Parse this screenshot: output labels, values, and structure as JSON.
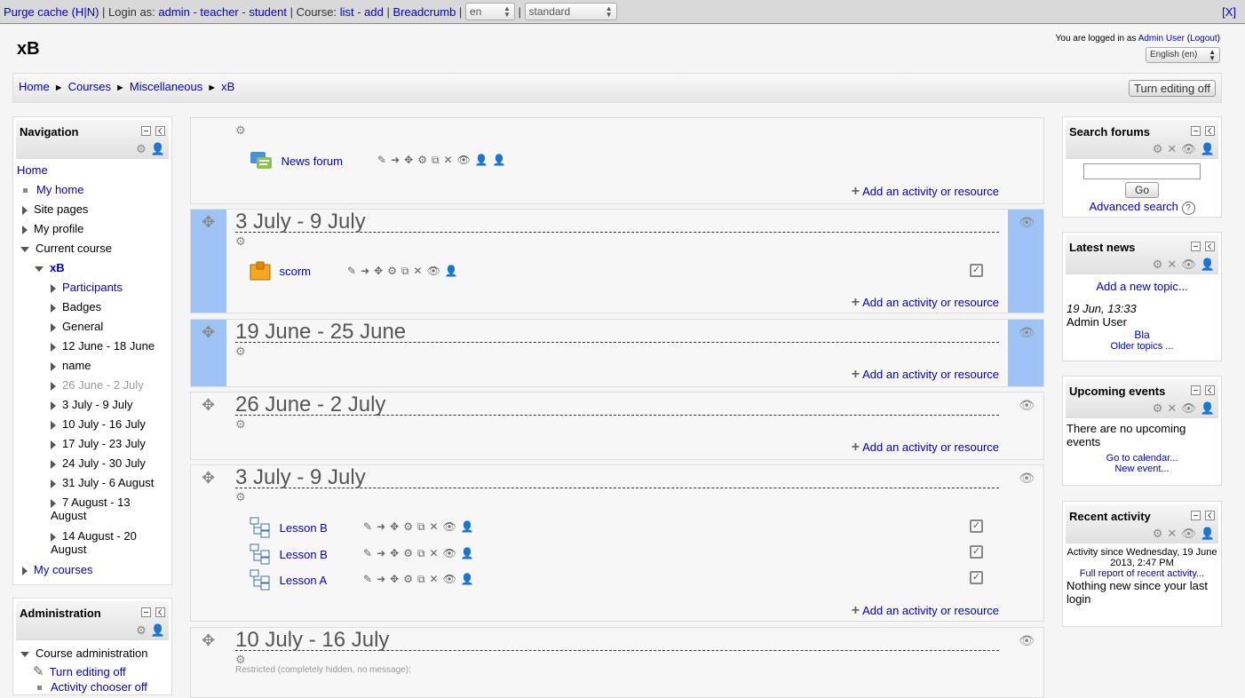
{
  "devbar": {
    "purge": "Purge cache (H|N)",
    "sep1": " | Login as: ",
    "admin": "admin",
    "teacher": "teacher",
    "student": "student",
    "sep2": " | Course: ",
    "list": "list",
    "add": "add",
    "breadcrumb": "Breadcrumb",
    "lang": "en",
    "theme": "standard",
    "close": "[X]"
  },
  "header": {
    "site_name": "xB",
    "logged_in": "You are logged in as",
    "user": "Admin User",
    "logout": "Logout",
    "language": "English (en)"
  },
  "breadcrumb": [
    "Home",
    "Courses",
    "Miscellaneous",
    "xB"
  ],
  "editing_button": "Turn editing off",
  "navigation": {
    "title": "Navigation",
    "home": "Home",
    "my_home": "My home",
    "site_pages": "Site pages",
    "my_profile": "My profile",
    "current_course": "Current course",
    "course": "xB",
    "items": [
      "Participants",
      "Badges",
      "General",
      "12 June - 18 June",
      "name",
      "26 June - 2 July",
      "3 July - 9 July",
      "10 July - 16 July",
      "17 July - 23 July",
      "24 July - 30 July",
      "31 July - 6 August",
      "7 August - 13 August",
      "14 August - 20 August"
    ],
    "my_courses": "My courses"
  },
  "administration": {
    "title": "Administration",
    "course_admin": "Course administration",
    "turn_editing": "Turn editing off",
    "activity_chooser": "Activity chooser off"
  },
  "sections": {
    "add_label": "Add an activity or resource",
    "s0": {
      "activity": "News forum"
    },
    "s1": {
      "title": "3 July - 9 July",
      "activity": "scorm"
    },
    "s2": {
      "title": "19 June - 25 June"
    },
    "s3": {
      "title": "26 June - 2 July"
    },
    "s4": {
      "title": "3 July - 9 July",
      "activities": [
        "Lesson B",
        "Lesson B",
        "Lesson A"
      ]
    },
    "s5": {
      "title": "10 July - 16 July",
      "restricted": "Restricted (completely hidden, no message):"
    }
  },
  "search_forums": {
    "title": "Search forums",
    "go": "Go",
    "advanced": "Advanced search"
  },
  "latest_news": {
    "title": "Latest news",
    "add_topic": "Add a new topic...",
    "date": "19 Jun, 13:33",
    "author": "Admin User",
    "post": "Bla",
    "older": "Older topics ..."
  },
  "upcoming": {
    "title": "Upcoming events",
    "none": "There are no upcoming events",
    "calendar": "Go to calendar...",
    "new_event": "New event..."
  },
  "recent": {
    "title": "Recent activity",
    "since": "Activity since Wednesday, 19 June 2013, 2:47 PM",
    "full": "Full report of recent activity...",
    "nothing": "Nothing new since your last login"
  }
}
